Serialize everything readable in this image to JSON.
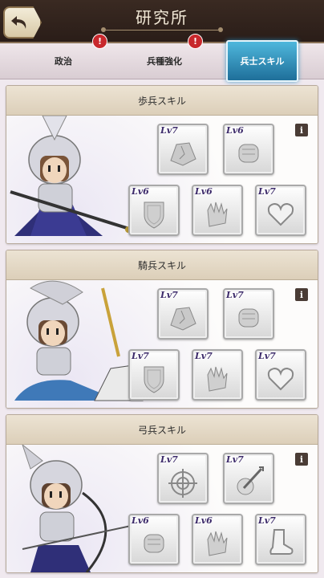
{
  "header": {
    "title": "研究所",
    "back_icon": "back-arrow-icon"
  },
  "tabs": [
    {
      "label": "政治",
      "badge": "!"
    },
    {
      "label": "兵種強化",
      "badge": "!"
    },
    {
      "label": "兵士スキル",
      "active": true
    }
  ],
  "colors": {
    "active_tab": "#2f8fbf",
    "level_text": "#3c2a6a",
    "badge": "#c8282c"
  },
  "panels": [
    {
      "title": "歩兵スキル",
      "info": "i",
      "character": "armored-infantry-with-spear",
      "skills": [
        {
          "level": "Lv7",
          "icon": "cracked-rock-icon"
        },
        {
          "level": "Lv6",
          "icon": "fist-icon"
        },
        {
          "level": "Lv6",
          "icon": "shield-icon"
        },
        {
          "level": "Lv6",
          "icon": "open-hand-icon"
        },
        {
          "level": "Lv7",
          "icon": "heart-icon"
        }
      ]
    },
    {
      "title": "騎兵スキル",
      "info": "i",
      "character": "armored-cavalry-with-sword",
      "skills": [
        {
          "level": "Lv7",
          "icon": "cracked-rock-icon"
        },
        {
          "level": "Lv7",
          "icon": "fist-icon"
        },
        {
          "level": "Lv7",
          "icon": "shield-icon"
        },
        {
          "level": "Lv7",
          "icon": "open-hand-icon"
        },
        {
          "level": "Lv7",
          "icon": "heart-icon"
        }
      ]
    },
    {
      "title": "弓兵スキル",
      "info": "i",
      "character": "armored-archer-with-bow",
      "skills": [
        {
          "level": "Lv7",
          "icon": "crosshair-icon"
        },
        {
          "level": "Lv7",
          "icon": "arrow-impact-icon"
        },
        {
          "level": "Lv6",
          "icon": "fist-icon"
        },
        {
          "level": "Lv6",
          "icon": "open-hand-icon"
        },
        {
          "level": "Lv7",
          "icon": "boot-icon"
        }
      ]
    }
  ]
}
